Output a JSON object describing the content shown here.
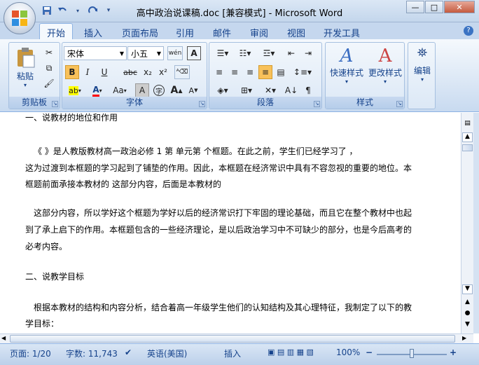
{
  "window": {
    "title": "高中政治说课稿.doc [兼容模式] - Microsoft Word"
  },
  "qat": {
    "icons": [
      "save-icon",
      "undo-icon",
      "redo-icon",
      "customize-icon"
    ]
  },
  "tabs": [
    "开始",
    "插入",
    "页面布局",
    "引用",
    "邮件",
    "审阅",
    "视图",
    "开发工具"
  ],
  "ribbon": {
    "clipboard": {
      "paste": "粘贴",
      "label": "剪贴板"
    },
    "font": {
      "name": "宋体",
      "size": "小五",
      "wen": "wén",
      "label": "字体",
      "bold": "B",
      "italic": "I",
      "underline": "U",
      "strike": "abc",
      "sub": "x₂",
      "sup": "x²",
      "aa": "Aa",
      "grow": "A",
      "shrink": "A",
      "clear_a": "A",
      "color_a": "A"
    },
    "paragraph": {
      "label": "段落"
    },
    "styles": {
      "quick": "快速样式",
      "change": "更改样式",
      "label": "样式"
    },
    "editing": {
      "label": "编辑"
    }
  },
  "document": {
    "lines": [
      "一、说教材的地位和作用",
      "《              》是人教版教材高一政治必修 1 第  单元第  个框题。在此之前，学生们已经学习了           ，",
      "这为过渡到本框题的学习起到了铺垫的作用。因此，本框题在经济常识中具有不容忽视的重要的地位。本",
      "框题前面承接本教材的              这部分内容，后面是本教材的",
      "这部分内容，所以学好这个框题为学好以后的经济常识打下牢固的理论基础，而且它在整个教材中也起",
      "到了承上启下的作用。本框题包含的一些经济理论，是以后政治学习中不可缺少的部分，也是今后高考的",
      "必考内容。",
      "二、说教学目标",
      "根据本教材的结构和内容分析，结合着高一年级学生他们的认知结构及其心理特征，我制定了以下的教",
      "学目标："
    ]
  },
  "status": {
    "page": "页面: 1/20",
    "words": "字数: 11,743",
    "language": "英语(美国)",
    "mode": "插入",
    "zoom": "100%",
    "minus": "−",
    "plus": "+"
  },
  "colors": {
    "accent": "#15428b",
    "ribbon": "#dbe7f5",
    "highlight": "#ffff00",
    "font_color": "#ff0000"
  }
}
